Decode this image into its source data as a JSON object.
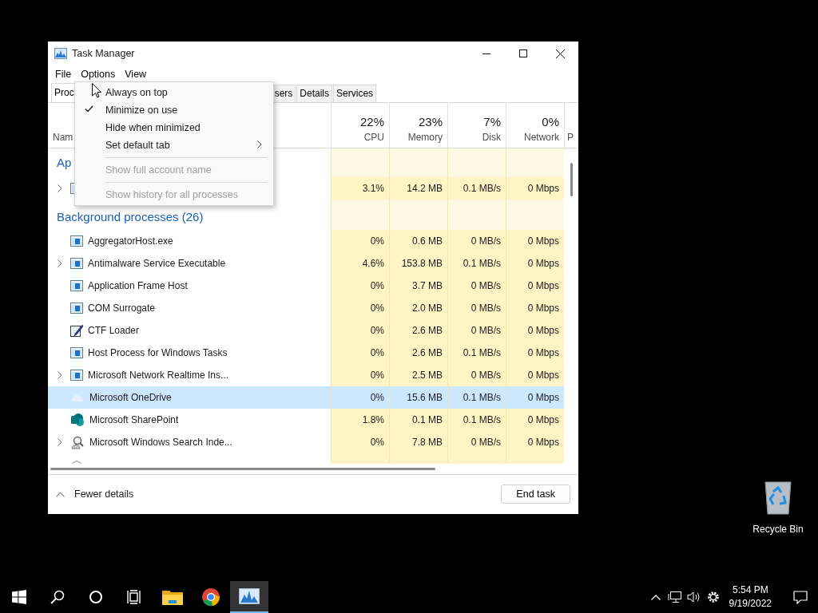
{
  "window": {
    "title": "Task Manager"
  },
  "menubar": [
    {
      "label": "File"
    },
    {
      "label": "Options"
    },
    {
      "label": "View"
    }
  ],
  "tabs": [
    {
      "label": "Proc",
      "selected": true
    },
    {
      "label": "sers",
      "selected": false
    },
    {
      "label": "Details",
      "selected": false
    },
    {
      "label": "Services",
      "selected": false
    }
  ],
  "columns": [
    {
      "label": "Nam"
    },
    {
      "percent": "22%",
      "label": "CPU"
    },
    {
      "percent": "23%",
      "label": "Memory"
    },
    {
      "percent": "7%",
      "label": "Disk"
    },
    {
      "percent": "0%",
      "label": "Network"
    },
    {
      "label": "P"
    }
  ],
  "groups": [
    {
      "title": "Ap",
      "rows": [
        {
          "kind": "window",
          "expandable": true,
          "selected": false,
          "values": [
            "3.1%",
            "14.2 MB",
            "0.1 MB/s",
            "0 Mbps"
          ]
        }
      ]
    },
    {
      "title": "Background processes (26)",
      "rows": [
        {
          "kind": "window",
          "name": "AggregatorHost.exe",
          "expandable": false,
          "selected": false,
          "values": [
            "0%",
            "0.6 MB",
            "0 MB/s",
            "0 Mbps"
          ]
        },
        {
          "kind": "window",
          "name": "Antimalware Service Executable",
          "expandable": true,
          "selected": false,
          "values": [
            "4.6%",
            "153.8 MB",
            "0.1 MB/s",
            "0 Mbps"
          ]
        },
        {
          "kind": "window",
          "name": "Application Frame Host",
          "expandable": false,
          "selected": false,
          "values": [
            "0%",
            "3.7 MB",
            "0 MB/s",
            "0 Mbps"
          ]
        },
        {
          "kind": "window",
          "name": "COM Surrogate",
          "expandable": false,
          "selected": false,
          "values": [
            "0%",
            "2.0 MB",
            "0 MB/s",
            "0 Mbps"
          ]
        },
        {
          "kind": "pencil",
          "name": "CTF Loader",
          "expandable": false,
          "selected": false,
          "values": [
            "0%",
            "2.6 MB",
            "0 MB/s",
            "0 Mbps"
          ]
        },
        {
          "kind": "window",
          "name": "Host Process for Windows Tasks",
          "expandable": false,
          "selected": false,
          "values": [
            "0%",
            "2.6 MB",
            "0.1 MB/s",
            "0 Mbps"
          ]
        },
        {
          "kind": "window",
          "name": "Microsoft Network Realtime Ins...",
          "expandable": true,
          "selected": false,
          "values": [
            "0%",
            "2.5 MB",
            "0 MB/s",
            "0 Mbps"
          ]
        },
        {
          "kind": "cloud",
          "name": "Microsoft OneDrive",
          "expandable": false,
          "selected": true,
          "values": [
            "0%",
            "15.6 MB",
            "0.1 MB/s",
            "0 Mbps"
          ]
        },
        {
          "kind": "logo",
          "name": "Microsoft SharePoint",
          "expandable": false,
          "selected": false,
          "values": [
            "1.8%",
            "0.1 MB",
            "0.1 MB/s",
            "0 Mbps"
          ]
        },
        {
          "kind": "search",
          "name": "Microsoft Windows Search Inde...",
          "expandable": true,
          "selected": false,
          "values": [
            "0%",
            "7.8 MB",
            "0 MB/s",
            "0 Mbps"
          ]
        },
        {
          "kind": "gear",
          "expandable": false,
          "selected": false
        }
      ]
    }
  ],
  "options_menu": [
    {
      "kind": "item",
      "label": "Always on top",
      "checked": false,
      "disabled": false
    },
    {
      "kind": "item",
      "label": "Minimize on use",
      "checked": true,
      "disabled": false
    },
    {
      "kind": "item",
      "label": "Hide when minimized",
      "checked": false,
      "disabled": false
    },
    {
      "kind": "submenu",
      "label": "Set default tab",
      "checked": false,
      "disabled": false
    },
    {
      "kind": "separator"
    },
    {
      "kind": "item",
      "label": "Show full account name",
      "checked": false,
      "disabled": true
    },
    {
      "kind": "separator"
    },
    {
      "kind": "item",
      "label": "Show history for all processes",
      "checked": false,
      "disabled": true
    }
  ],
  "footer": {
    "toggle": "Fewer details",
    "button": "End task"
  },
  "desktop": {
    "recycle_bin": "Recycle Bin"
  },
  "taskbar": {
    "apps": [
      {
        "kind": "start",
        "selected": false
      },
      {
        "kind": "search",
        "selected": false
      },
      {
        "kind": "cortana",
        "selected": false
      },
      {
        "kind": "taskview",
        "selected": false
      },
      {
        "kind": "explorer",
        "selected": false
      },
      {
        "kind": "browser",
        "selected": false
      },
      {
        "kind": "taskmanager",
        "selected": true
      }
    ],
    "tray": [
      {
        "kind": "chevron"
      },
      {
        "kind": "network"
      },
      {
        "kind": "volume"
      },
      {
        "kind": "settings"
      }
    ],
    "time": "5:54 PM",
    "date": "9/19/2022"
  }
}
